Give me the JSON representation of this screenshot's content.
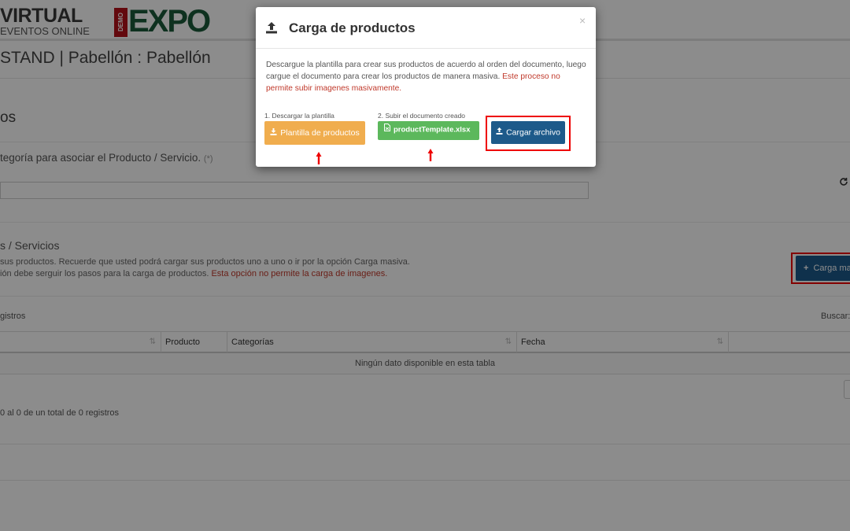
{
  "header": {
    "brand_title": "VIRTUAL",
    "brand_subtitle": "EVENTOS ONLINE",
    "expo_badge": "DEMO",
    "expo_text": "EXPO"
  },
  "page": {
    "title": "STAND | Pabellón : Pabellón",
    "section_title": "os",
    "category_label": "tegoría para asociar el Producto / Servicio.",
    "category_required": "(*)",
    "category_select_value": "",
    "products_title": "s / Servicios",
    "help_line1": "sus productos. Recuerde que usted podrá cargar sus productos uno a uno o ir por la opción Carga masiva.",
    "help_line2": "ión debe serguir los pasos para la carga de productos.",
    "help_warning": "Esta opción no permite la carga de imagenes.",
    "bulk_button": "Carga mas",
    "registros_label": "gistros",
    "search_label": "Buscar:",
    "table": {
      "columns": [
        "",
        "Producto",
        "Categorías",
        "Fecha",
        ""
      ],
      "empty_message": "Ningún dato disponible en esta tabla",
      "info": "0 al 0 de un total de 0 registros"
    }
  },
  "modal": {
    "title": "Carga de productos",
    "close": "×",
    "description": "Descargue la plantilla para crear sus productos de acuerdo al orden del documento, luego cargue el documento para crear los productos de manera masiva.",
    "warning": "Este proceso no permite subir imagenes masivamente.",
    "step1_label": "1. Descargar la plantilla",
    "step1_button": "Plantilla de productos",
    "step2_label": "2. Subir el documento creado",
    "step2_file": "productTemplate.xlsx",
    "upload_button": "Cargar archivo"
  },
  "colors": {
    "primary": "#1d5a8a",
    "warning_btn": "#f0ad4e",
    "success_btn": "#5cb85c",
    "highlight": "#ee0000",
    "warning_text": "#c0392b"
  }
}
